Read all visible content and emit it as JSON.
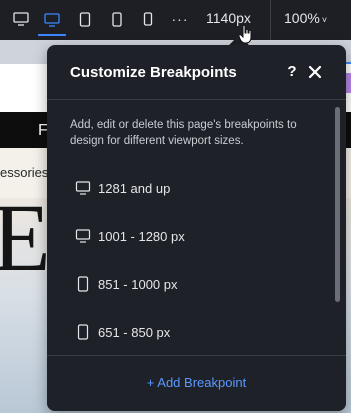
{
  "toolbar": {
    "devices": [
      {
        "name": "desktop-large",
        "active": false
      },
      {
        "name": "desktop",
        "active": true
      },
      {
        "name": "tablet",
        "active": false
      },
      {
        "name": "mobile-large",
        "active": false
      },
      {
        "name": "mobile",
        "active": false
      }
    ],
    "more_label": "···",
    "width_value": "1140px",
    "zoom_value": "100%",
    "zoom_chevron": "˅",
    "active_color": "#3b86ff"
  },
  "background_page": {
    "nav_letter": "F",
    "strip_text": "essories",
    "hero_letter": "E"
  },
  "panel": {
    "title": "Customize Breakpoints",
    "help_label": "?",
    "description": "Add, edit or delete this page's breakpoints to design for different viewport sizes.",
    "breakpoints": [
      {
        "label": "1281 and up",
        "icon": "desktop-icon"
      },
      {
        "label": "1001 - 1280 px",
        "icon": "desktop-icon"
      },
      {
        "label": "851 - 1000 px",
        "icon": "tablet-icon"
      },
      {
        "label": "651 - 850 px",
        "icon": "tablet-icon"
      }
    ],
    "add_button_label": "+ Add Breakpoint",
    "accent_color": "#5a98ff"
  }
}
